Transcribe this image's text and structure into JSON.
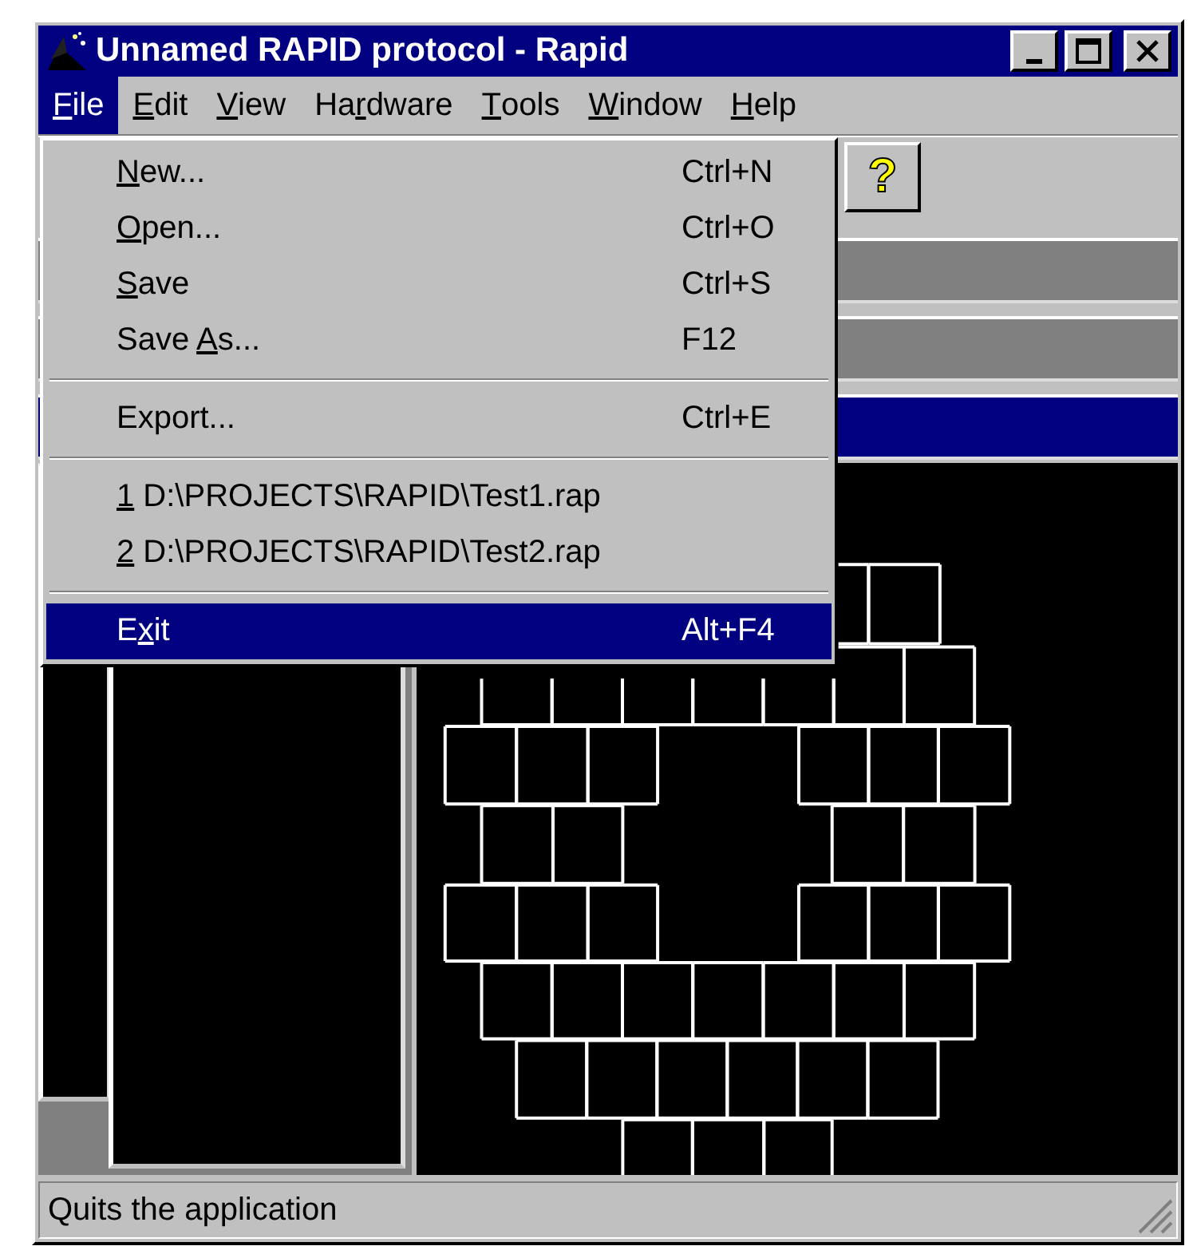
{
  "window": {
    "title": "Unnamed RAPID protocol - Rapid"
  },
  "menu_bar": [
    {
      "label": {
        "key": "F",
        "post": "ile"
      },
      "selected": true
    },
    {
      "label": {
        "key": "E",
        "post": "dit"
      },
      "selected": false
    },
    {
      "label": {
        "key": "V",
        "post": "iew"
      },
      "selected": false
    },
    {
      "label": {
        "pre": "Ha",
        "key": "r",
        "post": "dware"
      },
      "selected": false
    },
    {
      "label": {
        "key": "T",
        "post": "ools"
      },
      "selected": false
    },
    {
      "label": {
        "key": "W",
        "post": "indow"
      },
      "selected": false
    },
    {
      "label": {
        "key": "H",
        "post": "elp"
      },
      "selected": false
    }
  ],
  "file_menu": [
    {
      "kind": "item",
      "label": {
        "key": "N",
        "post": "ew..."
      },
      "shortcut": "Ctrl+N",
      "selected": false
    },
    {
      "kind": "item",
      "label": {
        "key": "O",
        "post": "pen..."
      },
      "shortcut": "Ctrl+O",
      "selected": false
    },
    {
      "kind": "item",
      "label": {
        "key": "S",
        "post": "ave"
      },
      "shortcut": "Ctrl+S",
      "selected": false
    },
    {
      "kind": "item",
      "label": {
        "pre": "Save ",
        "key": "A",
        "post": "s..."
      },
      "shortcut": "F12",
      "selected": false
    },
    {
      "kind": "separator"
    },
    {
      "kind": "item",
      "label": {
        "pre": "Export..."
      },
      "shortcut": "Ctrl+E",
      "selected": false
    },
    {
      "kind": "separator"
    },
    {
      "kind": "item",
      "label": {
        "key": "1",
        "post": " D:\\PROJECTS\\RAPID\\Test1.rap"
      },
      "selected": false
    },
    {
      "kind": "item",
      "label": {
        "key": "2",
        "post": " D:\\PROJECTS\\RAPID\\Test2.rap"
      },
      "selected": false
    },
    {
      "kind": "separator"
    },
    {
      "kind": "item",
      "label": {
        "pre": "E",
        "key": "x",
        "post": "it"
      },
      "shortcut": "Alt+F4",
      "selected": true
    }
  ],
  "toolbar": {
    "help_button": "?"
  },
  "status_bar": "Quits the application"
}
